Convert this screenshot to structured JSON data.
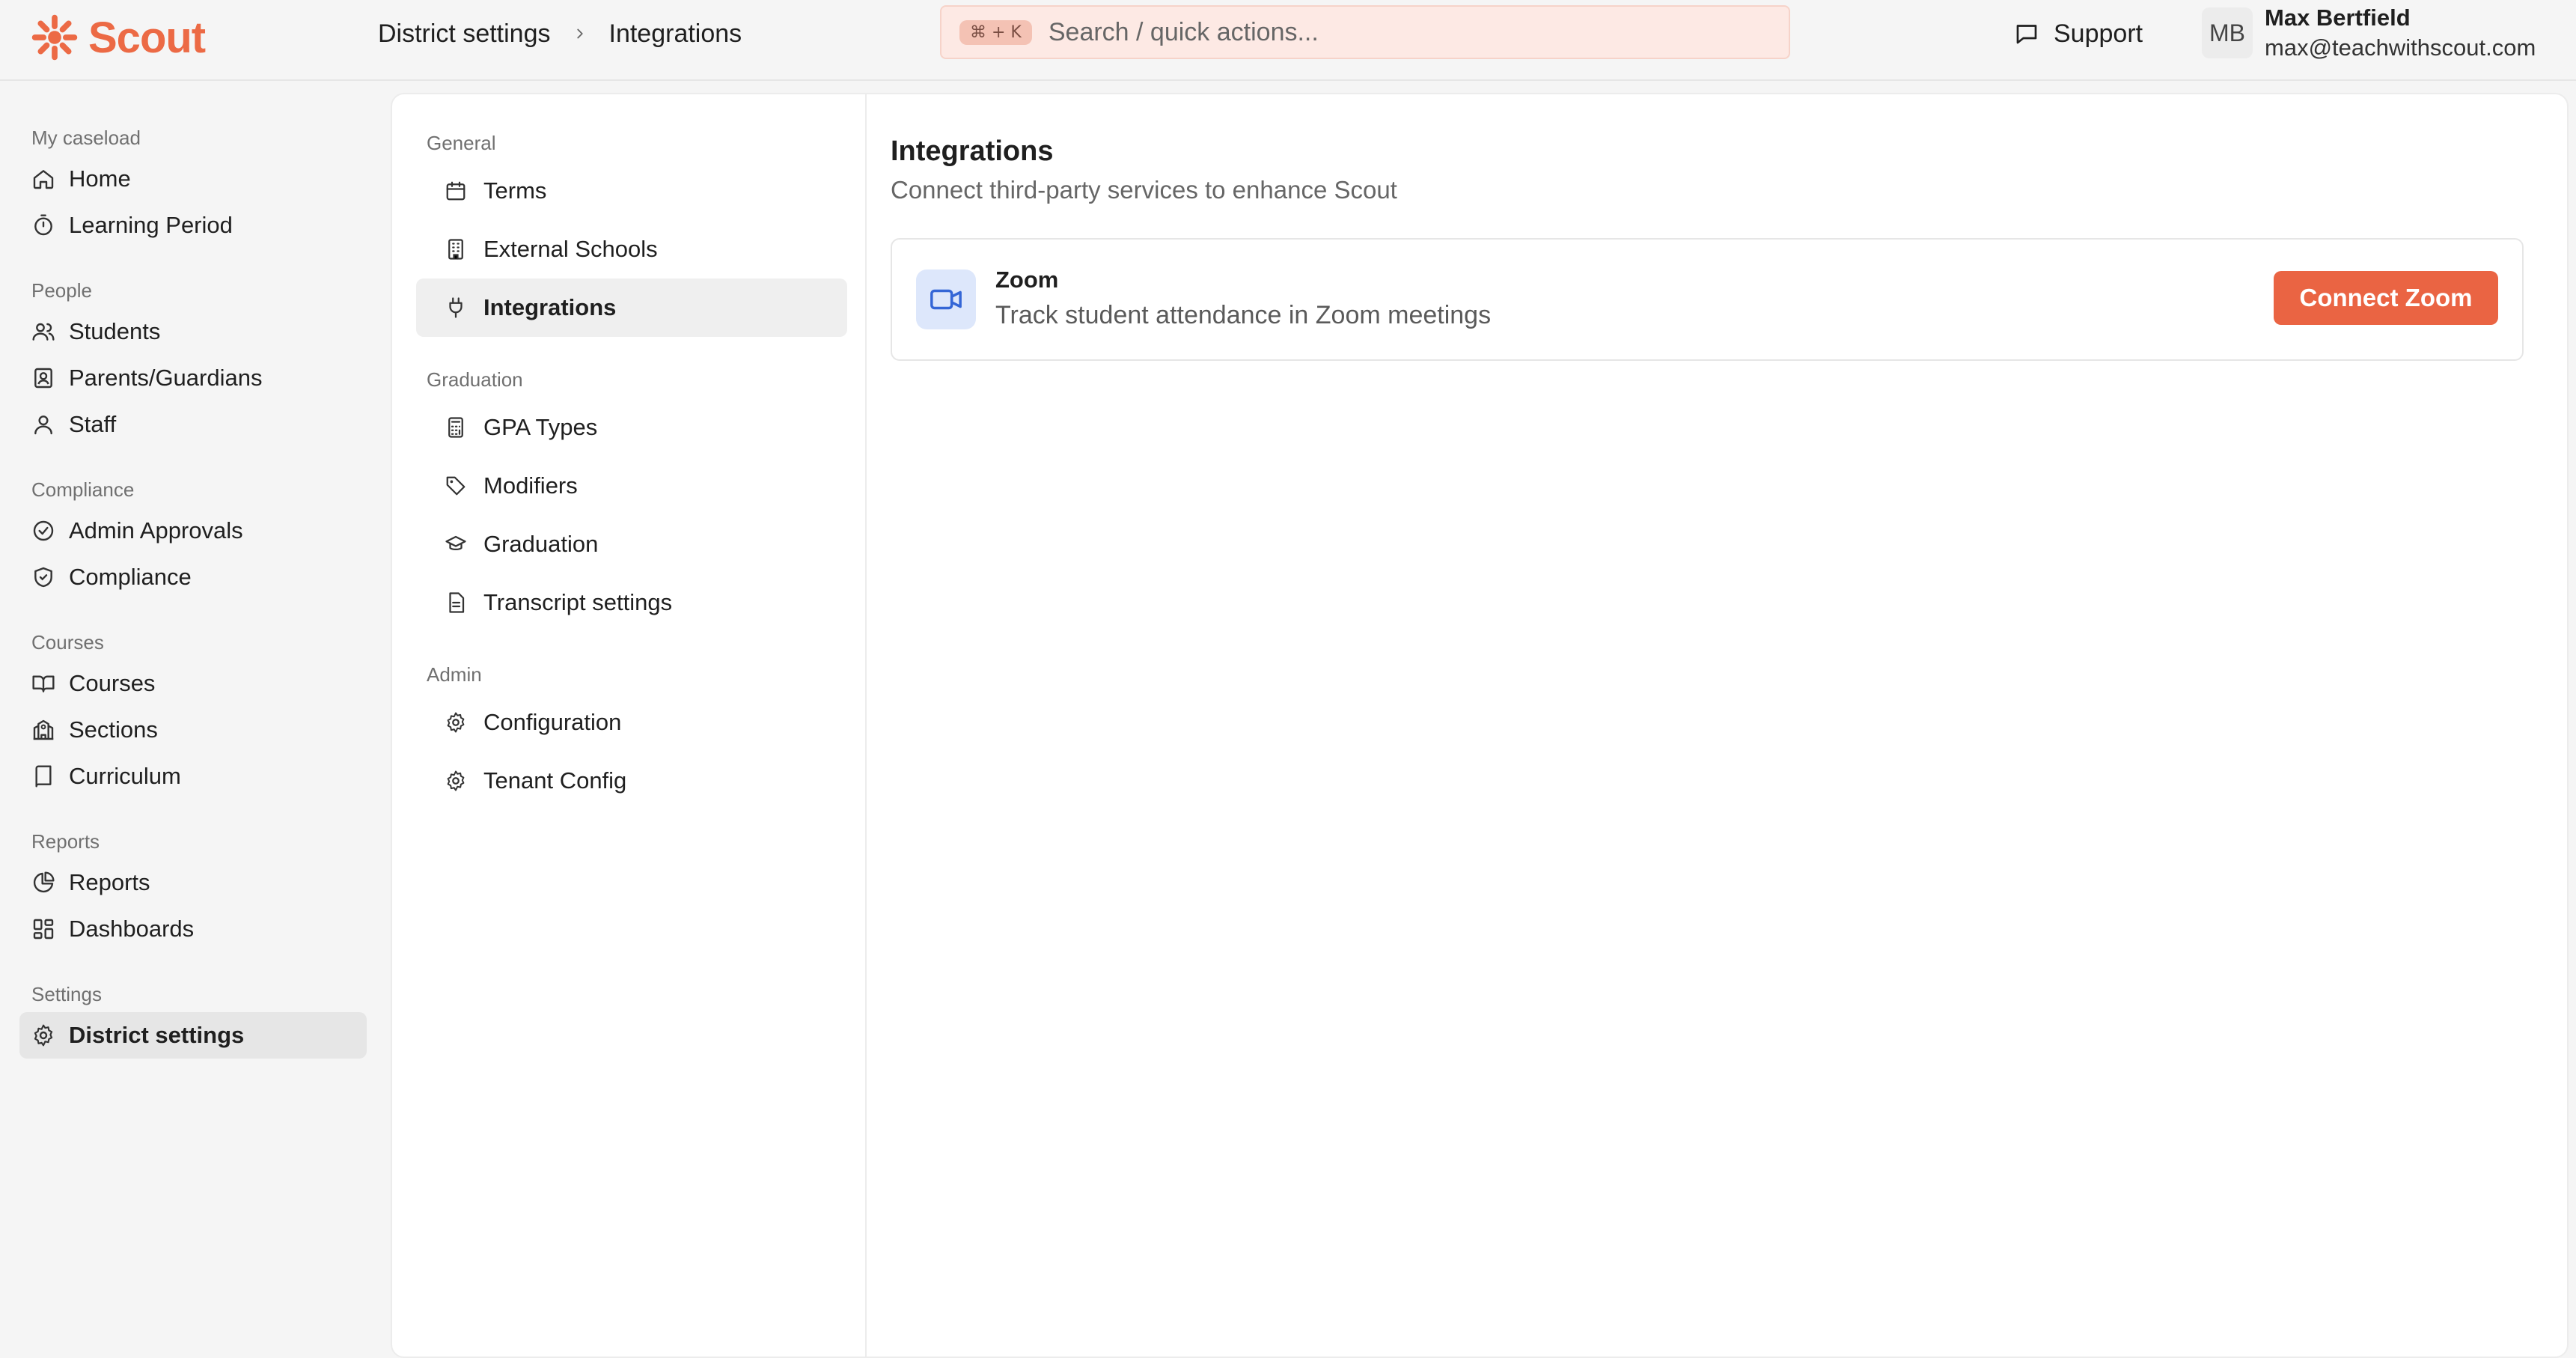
{
  "brand": {
    "name": "Scout",
    "color": "#ec6a45"
  },
  "breadcrumb": [
    "District settings",
    "Integrations"
  ],
  "search": {
    "shortcut": "⌘ + K",
    "placeholder": "Search / quick actions..."
  },
  "header": {
    "support_label": "Support"
  },
  "user": {
    "initials": "MB",
    "name": "Max Bertfield",
    "email": "max@teachwithscout.com"
  },
  "sidebar": {
    "sections": [
      {
        "title": "My caseload",
        "items": [
          {
            "label": "Home",
            "icon": "home-icon"
          },
          {
            "label": "Learning Period",
            "icon": "timer-icon"
          }
        ]
      },
      {
        "title": "People",
        "items": [
          {
            "label": "Students",
            "icon": "users-icon"
          },
          {
            "label": "Parents/Guardians",
            "icon": "contact-icon"
          },
          {
            "label": "Staff",
            "icon": "user-icon"
          }
        ]
      },
      {
        "title": "Compliance",
        "items": [
          {
            "label": "Admin Approvals",
            "icon": "check-circle-icon"
          },
          {
            "label": "Compliance",
            "icon": "shield-check-icon"
          }
        ]
      },
      {
        "title": "Courses",
        "items": [
          {
            "label": "Courses",
            "icon": "book-open-icon"
          },
          {
            "label": "Sections",
            "icon": "school-icon"
          },
          {
            "label": "Curriculum",
            "icon": "book-icon"
          }
        ]
      },
      {
        "title": "Reports",
        "items": [
          {
            "label": "Reports",
            "icon": "pie-chart-icon"
          },
          {
            "label": "Dashboards",
            "icon": "layout-dashboard-icon"
          }
        ]
      },
      {
        "title": "Settings",
        "items": [
          {
            "label": "District settings",
            "icon": "gear-icon",
            "active": true
          }
        ]
      }
    ]
  },
  "settings_nav": {
    "sections": [
      {
        "title": "General",
        "items": [
          {
            "label": "Terms",
            "icon": "calendar-icon"
          },
          {
            "label": "External Schools",
            "icon": "building-icon"
          },
          {
            "label": "Integrations",
            "icon": "plug-icon",
            "active": true
          }
        ]
      },
      {
        "title": "Graduation",
        "items": [
          {
            "label": "GPA Types",
            "icon": "calculator-icon"
          },
          {
            "label": "Modifiers",
            "icon": "tag-icon"
          },
          {
            "label": "Graduation",
            "icon": "graduation-cap-icon"
          },
          {
            "label": "Transcript settings",
            "icon": "file-text-icon"
          }
        ]
      },
      {
        "title": "Admin",
        "items": [
          {
            "label": "Configuration",
            "icon": "gear-icon"
          },
          {
            "label": "Tenant Config",
            "icon": "gear-icon"
          }
        ]
      }
    ]
  },
  "main": {
    "title": "Integrations",
    "subtitle": "Connect third-party services to enhance Scout",
    "integrations": [
      {
        "name": "Zoom",
        "description": "Track student attendance in Zoom meetings",
        "action": "Connect Zoom",
        "icon": "video-icon"
      }
    ]
  },
  "colors": {
    "accent": "#ea6443",
    "search_bg": "#fde9e4",
    "zoom_icon_bg": "#dde7fb",
    "zoom_icon": "#3466d6"
  }
}
